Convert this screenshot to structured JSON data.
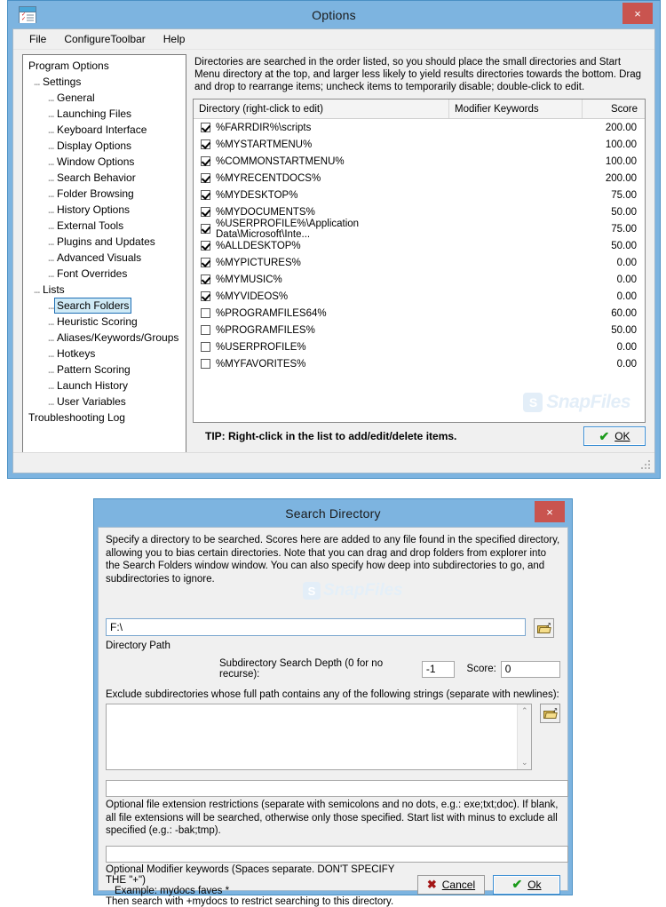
{
  "options_window": {
    "title": "Options",
    "icon_name": "options-window-icon",
    "close_label": "×",
    "menu": [
      "File",
      "ConfigureToolbar",
      "Help"
    ],
    "tree": [
      {
        "label": "Program Options",
        "depth": 0,
        "selected": false
      },
      {
        "label": "Settings",
        "depth": 1,
        "selected": false
      },
      {
        "label": "General",
        "depth": 2,
        "selected": false
      },
      {
        "label": "Launching Files",
        "depth": 2,
        "selected": false
      },
      {
        "label": "Keyboard Interface",
        "depth": 2,
        "selected": false
      },
      {
        "label": "Display Options",
        "depth": 2,
        "selected": false
      },
      {
        "label": "Window Options",
        "depth": 2,
        "selected": false
      },
      {
        "label": "Search Behavior",
        "depth": 2,
        "selected": false
      },
      {
        "label": "Folder Browsing",
        "depth": 2,
        "selected": false
      },
      {
        "label": "History Options",
        "depth": 2,
        "selected": false
      },
      {
        "label": "External Tools",
        "depth": 2,
        "selected": false
      },
      {
        "label": "Plugins and Updates",
        "depth": 2,
        "selected": false
      },
      {
        "label": "Advanced Visuals",
        "depth": 2,
        "selected": false
      },
      {
        "label": "Font Overrides",
        "depth": 2,
        "selected": false
      },
      {
        "label": "Lists",
        "depth": 1,
        "selected": false
      },
      {
        "label": "Search Folders",
        "depth": 2,
        "selected": true
      },
      {
        "label": "Heuristic Scoring",
        "depth": 2,
        "selected": false
      },
      {
        "label": "Aliases/Keywords/Groups",
        "depth": 2,
        "selected": false
      },
      {
        "label": "Hotkeys",
        "depth": 2,
        "selected": false
      },
      {
        "label": "Pattern Scoring",
        "depth": 2,
        "selected": false
      },
      {
        "label": "Launch History",
        "depth": 2,
        "selected": false
      },
      {
        "label": "User Variables",
        "depth": 2,
        "selected": false
      },
      {
        "label": "Troubleshooting Log",
        "depth": 0,
        "selected": false
      }
    ],
    "instructions": "Directories are searched in the order listed, so you should place the small directories and Start Menu directory at the top, and larger less likely to yield results directories towards the bottom.  Drag and drop to rearrange items; uncheck items to temporarily disable; double-click to edit.",
    "list": {
      "columns": [
        "Directory (right-click to edit)",
        "Modifier Keywords",
        "Score"
      ],
      "rows": [
        {
          "checked": true,
          "directory": "%FARRDIR%\\scripts",
          "keywords": "",
          "score": "200.00"
        },
        {
          "checked": true,
          "directory": "%MYSTARTMENU%",
          "keywords": "",
          "score": "100.00"
        },
        {
          "checked": true,
          "directory": "%COMMONSTARTMENU%",
          "keywords": "",
          "score": "100.00"
        },
        {
          "checked": true,
          "directory": "%MYRECENTDOCS%",
          "keywords": "",
          "score": "200.00"
        },
        {
          "checked": true,
          "directory": "%MYDESKTOP%",
          "keywords": "",
          "score": "75.00"
        },
        {
          "checked": true,
          "directory": "%MYDOCUMENTS%",
          "keywords": "",
          "score": "50.00"
        },
        {
          "checked": true,
          "directory": "%USERPROFILE%\\Application Data\\Microsoft\\Inte...",
          "keywords": "",
          "score": "75.00"
        },
        {
          "checked": true,
          "directory": "%ALLDESKTOP%",
          "keywords": "",
          "score": "50.00"
        },
        {
          "checked": true,
          "directory": "%MYPICTURES%",
          "keywords": "",
          "score": "0.00"
        },
        {
          "checked": true,
          "directory": "%MYMUSIC%",
          "keywords": "",
          "score": "0.00"
        },
        {
          "checked": true,
          "directory": "%MYVIDEOS%",
          "keywords": "",
          "score": "0.00"
        },
        {
          "checked": false,
          "directory": "%PROGRAMFILES64%",
          "keywords": "",
          "score": "60.00"
        },
        {
          "checked": false,
          "directory": "%PROGRAMFILES%",
          "keywords": "",
          "score": "50.00"
        },
        {
          "checked": false,
          "directory": "%USERPROFILE%",
          "keywords": "",
          "score": "0.00"
        },
        {
          "checked": false,
          "directory": "%MYFAVORITES%",
          "keywords": "",
          "score": "0.00"
        }
      ]
    },
    "watermark": "SnapFiles",
    "watermark_logo": "S",
    "tip": "TIP: Right-click in the list to add/edit/delete items.",
    "ok_button": "OK"
  },
  "search_dialog": {
    "title": "Search Directory",
    "close_label": "×",
    "description": "Specify a directory to be searched. Scores here are added to any file found in the specified directory, allowing you to bias certain directories.  Note that you can drag and drop folders from explorer into the Search Folders window window.  You can also specify how deep into subdirectories to go, and subdirectories to ignore.",
    "directory_path": {
      "value": "F:\\",
      "placeholder": "",
      "label": "Directory Path",
      "browse_icon": "folder-open-icon"
    },
    "depth": {
      "label": "Subdirectory Search Depth (0 for no recurse):",
      "value": "-1"
    },
    "score": {
      "label": "Score:",
      "value": "0"
    },
    "exclude": {
      "label": "Exclude subdirectories whose full path contains any of the following strings (separate with newlines):",
      "value": "",
      "browse_icon": "folder-open-icon",
      "scroll_up": "⌃",
      "scroll_down": "⌄"
    },
    "extensions": {
      "value": "",
      "note": "Optional file extension restrictions (separate with semicolons and no dots, e.g.: exe;txt;doc).  If blank, all file extensions will be searched, otherwise only those specified.  Start list with minus to exclude all specified (e.g.: -bak;tmp)."
    },
    "modifiers": {
      "value": "",
      "note_line1": "Optional Modifier keywords (Spaces separate. DON'T SPECIFY THE \"+\")",
      "note_line2": "Example: mydocs faves *",
      "note_line3": "Then search with +mydocs to restrict searching to this directory."
    },
    "watermark": "SnapFiles",
    "watermark_logo": "S",
    "cancel_button": "Cancel",
    "ok_button": "Ok"
  },
  "colors": {
    "titlebar": "#7db4e0",
    "close_button": "#c9544f",
    "selection": "#cfeaf6",
    "client": "#f0f0f0",
    "accent_border": "#3d8fd4"
  }
}
